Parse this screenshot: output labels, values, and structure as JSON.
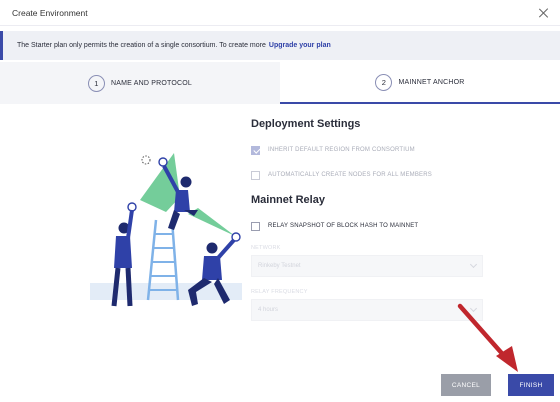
{
  "dialog": {
    "title": "Create Environment"
  },
  "banner": {
    "text": "The Starter plan only permits the creation of a single consortium. To create more",
    "link": "Upgrade your plan"
  },
  "steps": [
    {
      "number": "1",
      "label": "NAME AND PROTOCOL",
      "active": false
    },
    {
      "number": "2",
      "label": "MAINNET ANCHOR",
      "active": true
    }
  ],
  "deployment": {
    "title": "Deployment Settings",
    "inherit_region": {
      "label": "INHERIT DEFAULT REGION FROM CONSORTIUM",
      "checked": true,
      "disabled": true
    },
    "auto_nodes": {
      "label": "AUTOMATICALLY CREATE NODES FOR ALL MEMBERS",
      "checked": false,
      "disabled": true
    }
  },
  "mainnet": {
    "title": "Mainnet Relay",
    "relay_snapshot": {
      "label": "RELAY SNAPSHOT OF BLOCK HASH TO MAINNET",
      "checked": false
    },
    "network": {
      "label": "NETWORK",
      "value": "Rinkeby Testnet"
    },
    "frequency": {
      "label": "RELAY FREQUENCY",
      "value": "4 hours"
    }
  },
  "footer": {
    "cancel_label": "CANCEL",
    "finish_label": "FINISH"
  },
  "colors": {
    "accent": "#3a4aa8",
    "arrow": "#c0272d",
    "cancel": "#9a9ea8",
    "illustration_green": "#5cc488",
    "illustration_navy": "#1e2a6e"
  },
  "icons": [
    "close-icon",
    "checkbox-checked-icon",
    "chevron-down-icon",
    "pointer-arrow-icon"
  ]
}
